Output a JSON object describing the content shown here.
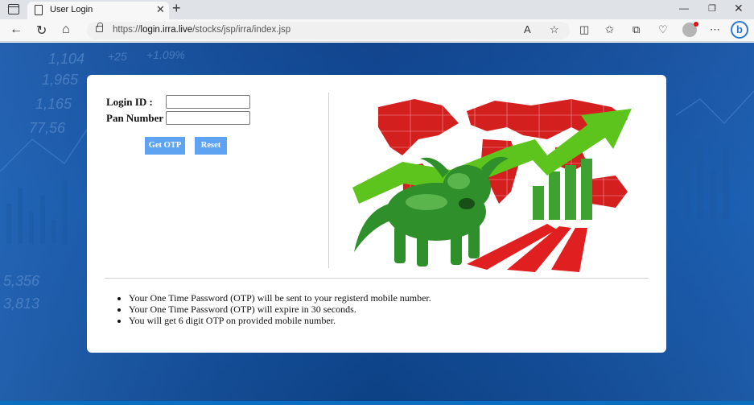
{
  "browser": {
    "tab_title": "User Login",
    "url_prefix": "https://",
    "url_domain": "login.irra.live",
    "url_path": "/stocks/jsp/irra/index.jsp",
    "icons": [
      "tab-actions-icon",
      "page-icon",
      "close-icon",
      "plus-icon",
      "back-icon",
      "refresh-icon",
      "home-icon",
      "lock-icon",
      "read-aloud-icon",
      "favorite-icon",
      "split-screen-icon",
      "favorites-icon",
      "collections-icon",
      "browser-essentials-icon",
      "profile-icon",
      "more-icon",
      "bing-icon"
    ]
  },
  "login": {
    "login_id_label": "Login ID :",
    "pan_label": "Pan Number :",
    "login_id_value": "",
    "pan_value": "",
    "get_otp_label": "Get OTP",
    "reset_label": "Reset"
  },
  "notes": [
    "Your One Time Password (OTP) will be sent to your registerd mobile number.",
    "Your One Time Password (OTP) will expire in 30 seconds.",
    "You will get 6 digit OTP on provided mobile number."
  ],
  "background_text": [
    "1,104",
    "1,965",
    "1,165",
    "77,56",
    "+25",
    "+1.09%",
    "5,356",
    "3,813"
  ],
  "colors": {
    "button": "#5ea3f2",
    "page_bg": "#0b4b9a",
    "bull": "#2f9e2f",
    "map": "#d41f1f",
    "arrow": "#5cc41d"
  }
}
